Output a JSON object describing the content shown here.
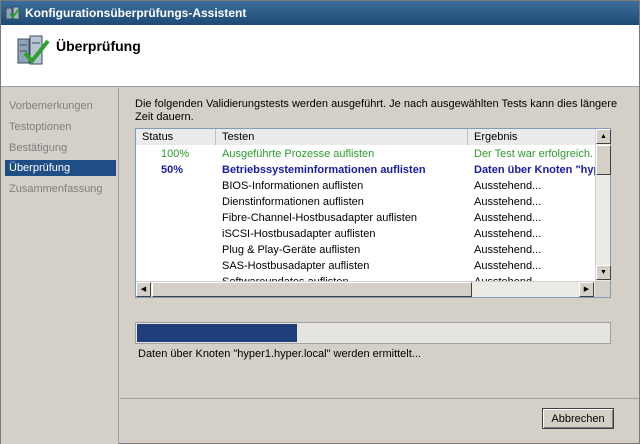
{
  "window": {
    "title": "Konfigurationsüberprüfungs-Assistent"
  },
  "header": {
    "title": "Überprüfung",
    "icon": "checklist-server-icon"
  },
  "nav": {
    "items": [
      {
        "label": "Vorbemerkungen",
        "active": false
      },
      {
        "label": "Testoptionen",
        "active": false
      },
      {
        "label": "Bestätigung",
        "active": false
      },
      {
        "label": "Überprüfung",
        "active": true
      },
      {
        "label": "Zusammenfassung",
        "active": false
      }
    ]
  },
  "main": {
    "intro": "Die folgenden Validierungstests werden ausgeführt. Je nach ausgewählten Tests kann dies längere Zeit dauern.",
    "table": {
      "columns": [
        "Status",
        "Testen",
        "Ergebnis"
      ],
      "rows": [
        {
          "status": "100%",
          "test": "Ausgeführte Prozesse auflisten",
          "result": "Der Test war erfolgreich.",
          "state": "done"
        },
        {
          "status": "50%",
          "test": "Betriebssysteminformationen auflisten",
          "result": "Daten über Knoten \"hyper1...",
          "state": "running"
        },
        {
          "status": "",
          "test": "BIOS-Informationen auflisten",
          "result": "Ausstehend...",
          "state": "pending"
        },
        {
          "status": "",
          "test": "Dienstinformationen auflisten",
          "result": "Ausstehend...",
          "state": "pending"
        },
        {
          "status": "",
          "test": "Fibre-Channel-Hostbusadapter auflisten",
          "result": "Ausstehend...",
          "state": "pending"
        },
        {
          "status": "",
          "test": "iSCSI-Hostbusadapter auflisten",
          "result": "Ausstehend...",
          "state": "pending"
        },
        {
          "status": "",
          "test": "Plug & Play-Geräte auflisten",
          "result": "Ausstehend...",
          "state": "pending"
        },
        {
          "status": "",
          "test": "SAS-Hostbusadapter auflisten",
          "result": "Ausstehend...",
          "state": "pending"
        },
        {
          "status": "",
          "test": "Softwareupdates auflisten",
          "result": "Ausstehend...",
          "state": "pending"
        }
      ]
    },
    "progress": {
      "fraction": 0.34,
      "color": "#1f3e7a"
    },
    "status_text": "Daten über Knoten \"hyper1.hyper.local\" werden ermittelt..."
  },
  "footer": {
    "cancel_label": "Abbrechen"
  },
  "colors": {
    "done": "#2e9b2e",
    "running": "#1a1aa8",
    "pending": "#000000",
    "nav_active": "#1f4e87"
  }
}
